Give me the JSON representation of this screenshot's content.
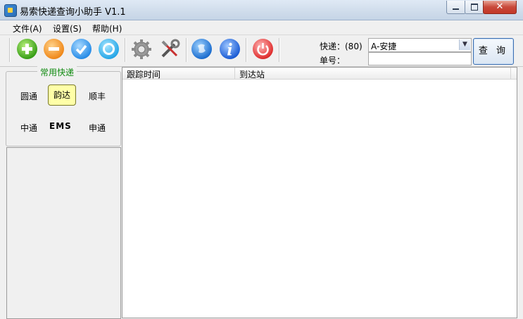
{
  "window": {
    "title": "易索快递查询小助手 V1.1"
  },
  "menu": [
    "文件(A)",
    "设置(S)",
    "帮助(H)"
  ],
  "toolbar": {
    "icons": [
      "add-icon",
      "remove-icon",
      "check-icon",
      "ring-icon",
      "settings-gear-icon",
      "tools-icon",
      "globe-icon",
      "info-icon",
      "power-icon"
    ]
  },
  "query": {
    "courier_label": "快递：(80)",
    "courier_selected": "A-安捷",
    "tracking_label": "单号：",
    "tracking_value": "",
    "button_label": "查 询"
  },
  "common_couriers": {
    "title": "常用快递",
    "items": [
      "圆通",
      "韵达",
      "顺丰",
      "中通",
      "EMS",
      "申通"
    ],
    "selected": "韵达"
  },
  "results": {
    "columns": [
      "跟踪时间",
      "到达站"
    ],
    "rows": []
  },
  "colors": {
    "accent_green": "#0f8a0f",
    "selected_bg": "#ffffa8"
  }
}
